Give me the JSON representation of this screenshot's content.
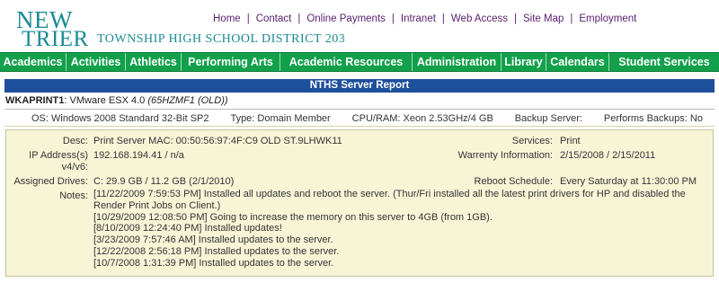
{
  "header": {
    "logo": {
      "line1": "NEW",
      "line2": "TRIER",
      "subtitle": "TOWNSHIP HIGH SCHOOL DISTRICT 203"
    },
    "top_links": [
      "Home",
      "Contact",
      "Online Payments",
      "Intranet",
      "Web Access",
      "Site Map",
      "Employment"
    ]
  },
  "nav": {
    "items": [
      "Academics",
      "Activities",
      "Athletics",
      "Performing Arts",
      "Academic Resources",
      "Administration",
      "Library",
      "Calendars",
      "Student Services"
    ]
  },
  "report": {
    "title": "NTHS Server Report",
    "server_name": "WKAPRINT1",
    "server_desc": "VMware ESX 4.0",
    "server_desc_italic": "(65HZMF1 (OLD))",
    "summary": {
      "os": "OS: Windows 2008 Standard 32-Bit SP2",
      "type": "Type: Domain Member",
      "cpu_ram": "CPU/RAM: Xeon 2.53GHz/4 GB",
      "backup_server": "Backup Server:",
      "performs_backups": "Performs Backups: No"
    },
    "details": {
      "desc_label": "Desc:",
      "desc_value": "Print Server MAC: 00:50:56:97:4F:C9 OLD ST.9LHWK11",
      "services_label": "Services:",
      "services_value": "Print",
      "ip_label_line1": "IP Address(s)",
      "ip_label_line2": "v4/v6:",
      "ip_value": "192.168.194.41 / n/a",
      "warranty_label": "Warrenty Information:",
      "warranty_value": "2/15/2008 / 2/15/2011",
      "drives_label": "Assigned Drives:",
      "drives_value": "C: 29.9 GB / 11.2 GB (2/1/2010)",
      "reboot_label": "Reboot Schedule:",
      "reboot_value": "Every Saturday at 11:30:00 PM",
      "notes_label": "Notes:",
      "notes": [
        "[11/22/2009 7:59:53 PM] Installed all updates and reboot the server. (Thur/Fri installed all the latest print drivers for HP and disabled the Render Print Jobs on Client.)",
        "[10/29/2009 12:08:50 PM] Going to increase the memory on this server to 4GB (from 1GB).",
        "[8/10/2009 12:24:40 PM] Installed updates!",
        "[3/23/2009 7:57:46 AM] Installed updates to the server.",
        "[12/22/2008 2:56:18 PM] Installed updates to the server.",
        "[10/7/2008 1:31:39 PM] Installed updates to the server."
      ]
    }
  }
}
